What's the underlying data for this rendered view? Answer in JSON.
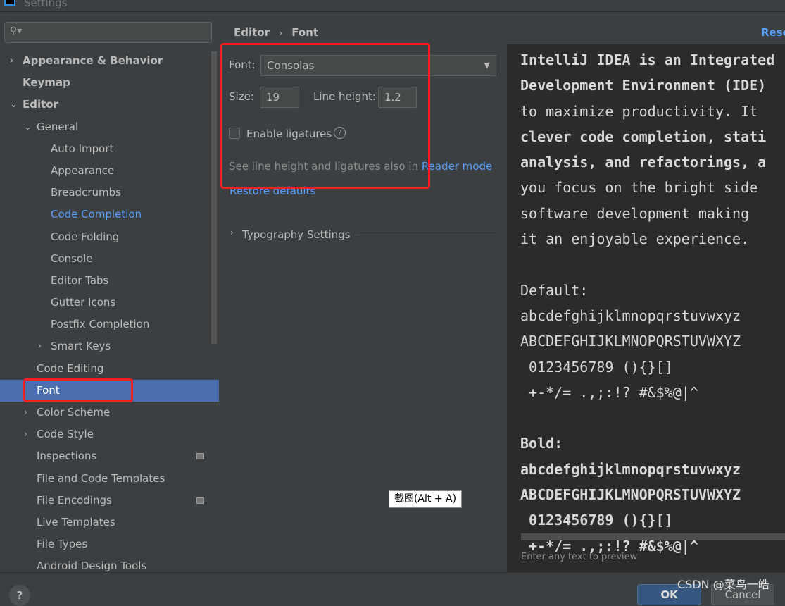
{
  "window": {
    "title": "Settings"
  },
  "search": {
    "icon": "search-icon"
  },
  "tree": [
    {
      "label": "Appearance & Behavior",
      "level": 0,
      "arrow": "›",
      "bold": true
    },
    {
      "label": "Keymap",
      "level": 0,
      "bold": true
    },
    {
      "label": "Editor",
      "level": 0,
      "arrow": "⌄",
      "bold": true
    },
    {
      "label": "General",
      "level": 1,
      "arrow": "⌄"
    },
    {
      "label": "Auto Import",
      "level": 2
    },
    {
      "label": "Appearance",
      "level": 2
    },
    {
      "label": "Breadcrumbs",
      "level": 2
    },
    {
      "label": "Code Completion",
      "level": 2,
      "link": true
    },
    {
      "label": "Code Folding",
      "level": 2
    },
    {
      "label": "Console",
      "level": 2
    },
    {
      "label": "Editor Tabs",
      "level": 2
    },
    {
      "label": "Gutter Icons",
      "level": 2
    },
    {
      "label": "Postfix Completion",
      "level": 2
    },
    {
      "label": "Smart Keys",
      "level": 2,
      "arrow": "›"
    },
    {
      "label": "Code Editing",
      "level": 1
    },
    {
      "label": "Font",
      "level": 1,
      "selected": true
    },
    {
      "label": "Color Scheme",
      "level": 1,
      "arrow": "›"
    },
    {
      "label": "Code Style",
      "level": 1,
      "arrow": "›"
    },
    {
      "label": "Inspections",
      "level": 1,
      "badge": true
    },
    {
      "label": "File and Code Templates",
      "level": 1
    },
    {
      "label": "File Encodings",
      "level": 1,
      "badge": true
    },
    {
      "label": "Live Templates",
      "level": 1
    },
    {
      "label": "File Types",
      "level": 1
    },
    {
      "label": "Android Design Tools",
      "level": 1
    }
  ],
  "breadcrumb": {
    "parent": "Editor",
    "sep": "›",
    "current": "Font",
    "reset": "Reset"
  },
  "font": {
    "label": "Font:",
    "value": "Consolas"
  },
  "size": {
    "label": "Size:",
    "value": "19"
  },
  "line_height": {
    "label": "Line height:",
    "value": "1.2"
  },
  "ligatures": {
    "label": "Enable ligatures",
    "checked": false
  },
  "hint": {
    "text": "See line height and ligatures also in ",
    "link": "Reader mode"
  },
  "restore": "Restore defaults",
  "typography": "Typography Settings",
  "preview": {
    "lines": [
      "IntelliJ IDEA is an Integrated",
      "Development Environment (IDE)",
      "to maximize productivity. It",
      "clever code completion, stati",
      "analysis, and refactorings, a",
      "you focus on the bright side",
      "software development making",
      "it an enjoyable experience."
    ],
    "default_label": "Default:",
    "bold_label": "Bold:",
    "samples": [
      "abcdefghijklmnopqrstuvwxyz",
      "ABCDEFGHIJKLMNOPQRSTUVWXYZ",
      " 0123456789 (){}[]",
      " +-*/= .,;:!? #&$%@|^"
    ],
    "placeholder": "Enter any text to preview"
  },
  "buttons": {
    "ok": "OK",
    "cancel": "Cancel",
    "help": "?"
  },
  "tooltip": "截图(Alt + A)",
  "watermark": "CSDN @菜鸟一皓",
  "colors": {
    "accent": "#4b6eaf",
    "link": "#589df6",
    "highlight": "#f02020"
  }
}
